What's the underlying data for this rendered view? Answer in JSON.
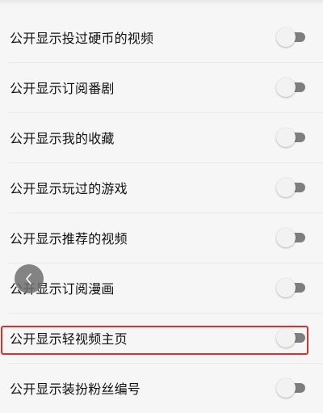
{
  "settings": {
    "items": [
      {
        "label": "公开显示投过硬币的视频",
        "enabled": false
      },
      {
        "label": "公开显示订阅番剧",
        "enabled": false
      },
      {
        "label": "公开显示我的收藏",
        "enabled": false
      },
      {
        "label": "公开显示玩过的游戏",
        "enabled": false
      },
      {
        "label": "公开显示推荐的视频",
        "enabled": false
      },
      {
        "label": "公开显示订阅漫画",
        "enabled": false
      },
      {
        "label": "公开显示轻视频主页",
        "enabled": false,
        "highlighted": true
      },
      {
        "label": "公开显示装扮粉丝编号",
        "enabled": false
      }
    ]
  },
  "floating_back_button": {
    "icon": "chevron-left-icon"
  },
  "colors": {
    "highlight": "#d8312f",
    "toggle_off_track": "#7e7e7e",
    "toggle_knob": "#f2f2f2",
    "background": "#f6f6f6"
  }
}
